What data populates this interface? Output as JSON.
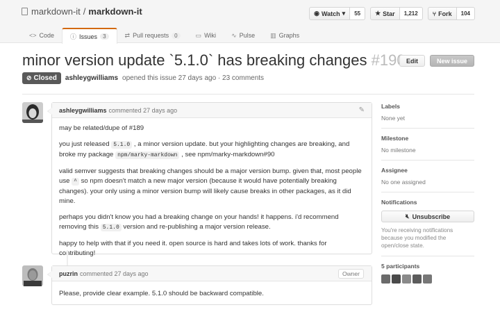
{
  "repo": {
    "owner": "markdown-it",
    "separator": "/",
    "name": "markdown-it"
  },
  "actions": {
    "watch": {
      "label": "Watch",
      "count": "55"
    },
    "star": {
      "label": "Star",
      "count": "1,212"
    },
    "fork": {
      "label": "Fork",
      "count": "104"
    }
  },
  "tabs": [
    {
      "label": "Code"
    },
    {
      "label": "Issues",
      "count": "3"
    },
    {
      "label": "Pull requests",
      "count": "0"
    },
    {
      "label": "Wiki"
    },
    {
      "label": "Pulse"
    },
    {
      "label": "Graphs"
    }
  ],
  "issue": {
    "title": "minor version update `5.1.0` has breaking changes",
    "number": "#190",
    "edit_label": "Edit",
    "new_label": "New issue",
    "state": "Closed",
    "author": "ashleygwilliams",
    "meta_text": "opened this issue 27 days ago · 23 comments"
  },
  "comments": [
    {
      "author": "ashleygwilliams",
      "time": "commented 27 days ago",
      "p1": "may be related/dupe of #189",
      "p2a": "you just released",
      "p2code": "5.1.0",
      "p2b": ", a minor version update. but your highlighting changes are breaking, and broke my package",
      "p2code2": "npm/marky-markdown",
      "p2c": ", see npm/marky-markdown#90",
      "p3a": "valid semver suggests that breaking changes should be a major version bump. given that, most people use",
      "p3code": "^",
      "p3b": "so npm doesn't match a new major version (because it would have potentially breaking changes). your only using a minor version bump will likely cause breaks in other packages, as it did mine.",
      "p4a": "perhaps you didn't know you had a breaking change on your hands! it happens. i'd recommend removing this",
      "p4code": "5.1.0",
      "p4b": "version and re-publishing a major version release.",
      "p5": "happy to help with that if you need it. open source is hard and takes lots of work. thanks for contributing!"
    },
    {
      "author": "puzrin",
      "time": "commented 27 days ago",
      "badge": "Owner",
      "p1": "Please, provide clear example. 5.1.0 should be backward compatible."
    }
  ],
  "sidebar": {
    "labels": {
      "heading": "Labels",
      "value": "None yet"
    },
    "milestone": {
      "heading": "Milestone",
      "value": "No milestone"
    },
    "assignee": {
      "heading": "Assignee",
      "value": "No one assigned"
    },
    "notifications": {
      "heading": "Notifications",
      "button": "Unsubscribe",
      "note": "You're receiving notifications because you modified the open/close state."
    },
    "participants": {
      "heading": "5 participants"
    }
  }
}
